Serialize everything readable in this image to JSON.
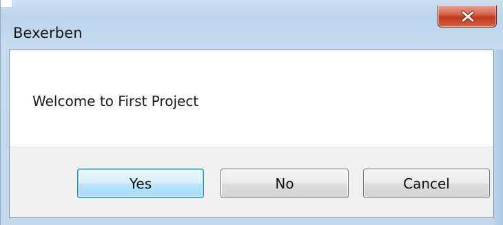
{
  "window": {
    "title": "Bexerben",
    "close_icon": "close-x-icon"
  },
  "dialog": {
    "message": "Welcome to First Project"
  },
  "buttons": {
    "yes_label": "Yes",
    "no_label": "No",
    "cancel_label": "Cancel",
    "default": "Yes"
  },
  "colors": {
    "close_button": "#c1391c",
    "default_button_border": "#3c7fb1",
    "button_area": "#f0f0f0"
  }
}
